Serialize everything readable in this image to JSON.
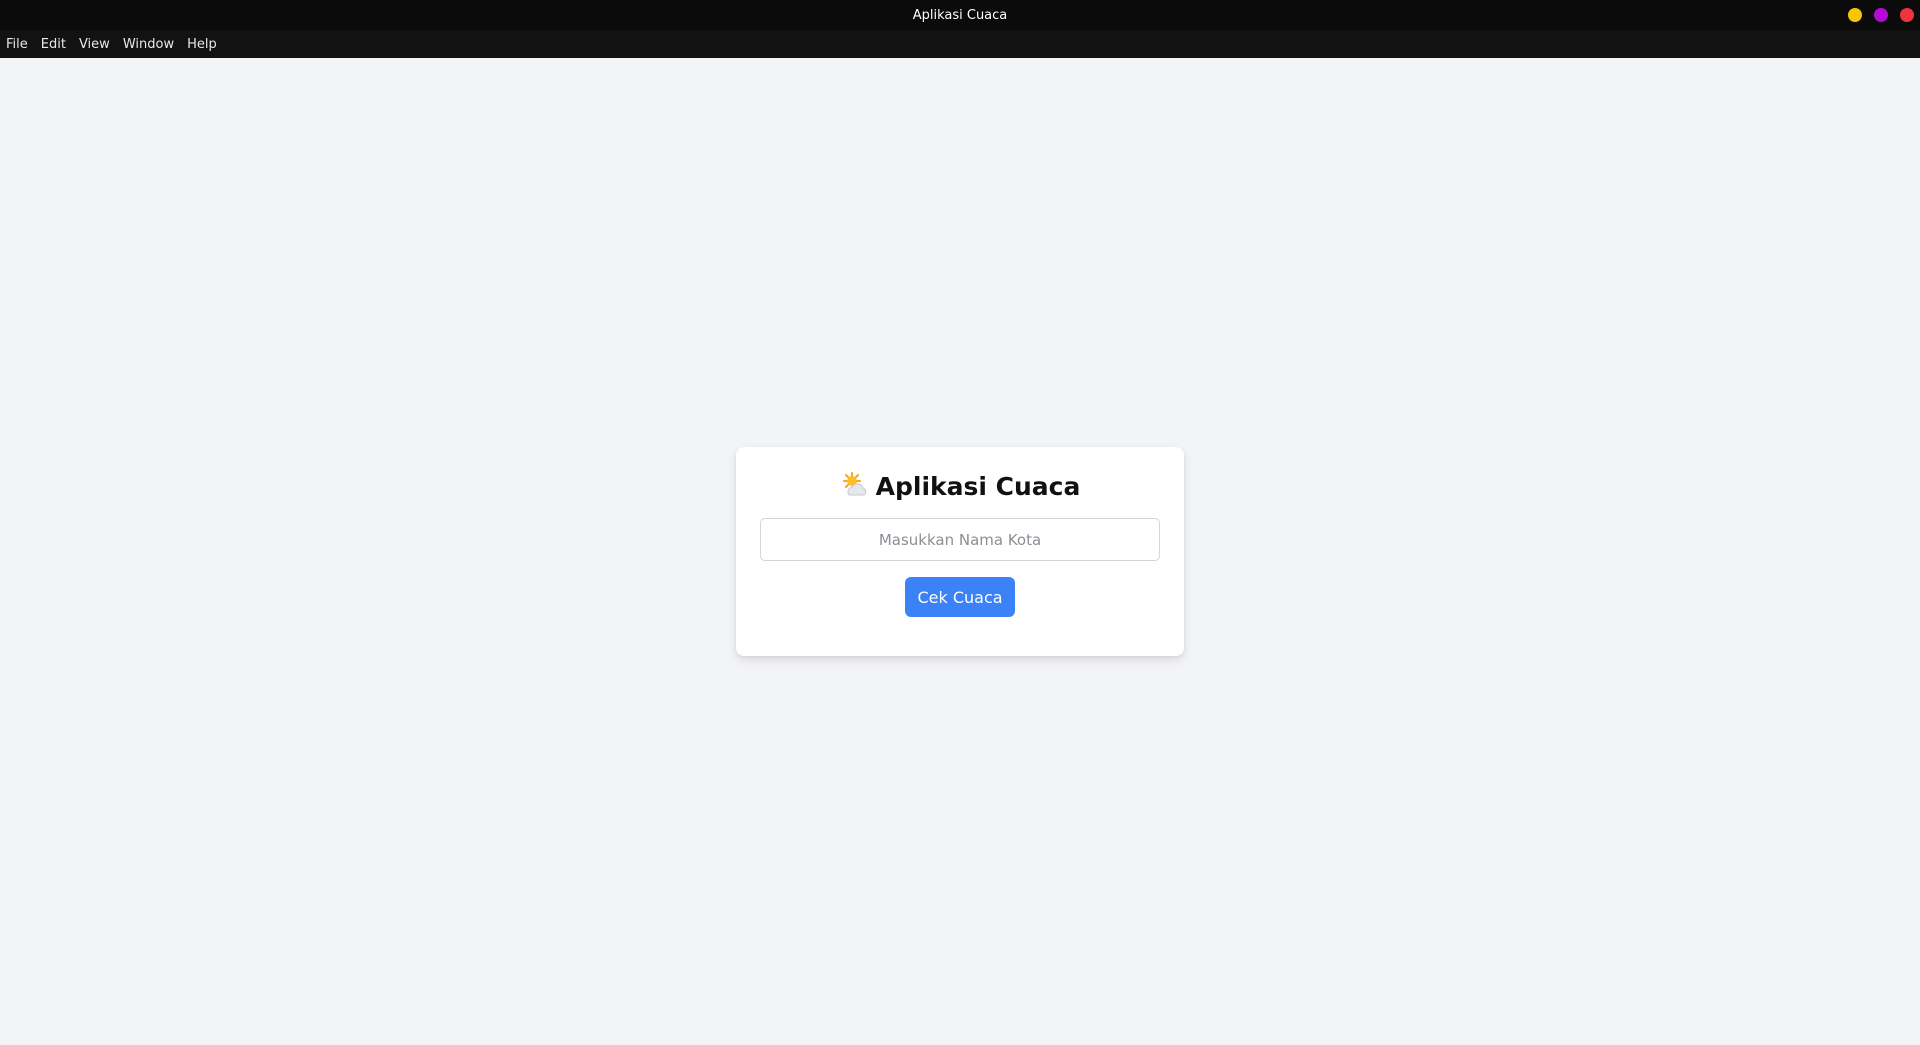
{
  "window": {
    "title": "Aplikasi Cuaca",
    "controls": {
      "minimize_color": "#f6c700",
      "maximize_color": "#b30ad6",
      "close_color": "#f0343e"
    }
  },
  "menubar": {
    "items": [
      {
        "label": "File"
      },
      {
        "label": "Edit"
      },
      {
        "label": "View"
      },
      {
        "label": "Window"
      },
      {
        "label": "Help"
      }
    ]
  },
  "card": {
    "icon": "sun-behind-cloud-icon",
    "title": "Aplikasi Cuaca",
    "input": {
      "value": "",
      "placeholder": "Masukkan Nama Kota"
    },
    "button_label": "Cek Cuaca",
    "accent_color": "#3b82f6"
  }
}
